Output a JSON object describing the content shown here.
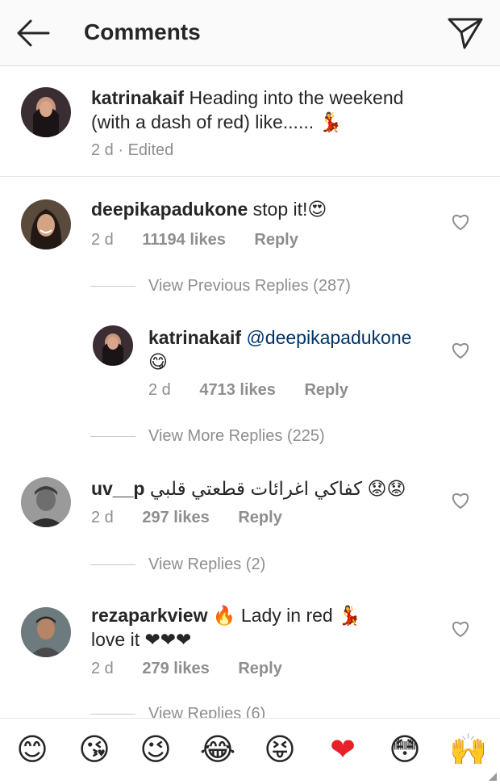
{
  "header": {
    "title": "Comments",
    "back_icon": "arrow-left-icon",
    "send_icon": "paper-plane-icon"
  },
  "caption": {
    "username": "katrinakaif",
    "text_line1": "Heading into the weekend",
    "text_line2": "(with a dash of red)  like...... 💃",
    "time": "2 d",
    "edited": "· Edited"
  },
  "comments": [
    {
      "username": "deepikapadukone",
      "text": "stop it!😍",
      "time": "2 d",
      "likes": "11194 likes",
      "reply": "Reply",
      "replies_link": "View Previous Replies (287)",
      "reply_item": {
        "username": "katrinakaif",
        "mention": "@deepikapadukone",
        "text": "😋",
        "time": "2 d",
        "likes": "4713 likes",
        "reply": "Reply"
      },
      "more_replies": "View More Replies (225)"
    },
    {
      "username": "uv__p",
      "text": "كفاكي  اغرائات قطعتي قلبي 😟😟",
      "time": "2 d",
      "likes": "297 likes",
      "reply": "Reply",
      "replies_link": "View Replies (2)"
    },
    {
      "username": "rezaparkview",
      "text_line1": "🔥 Lady in red 💃",
      "text_line2": "love it ❤❤❤",
      "time": "2 d",
      "likes": "279 likes",
      "reply": "Reply",
      "replies_link": "View Replies (6)"
    }
  ],
  "emoji_bar": [
    "😊",
    "😘",
    "😉",
    "😂",
    "😝",
    "❤",
    "😳",
    "🙌"
  ],
  "colors": {
    "text": "#262626",
    "secondary": "#8e8e8e",
    "mention": "#003569",
    "heart_red": "#e8202a"
  }
}
